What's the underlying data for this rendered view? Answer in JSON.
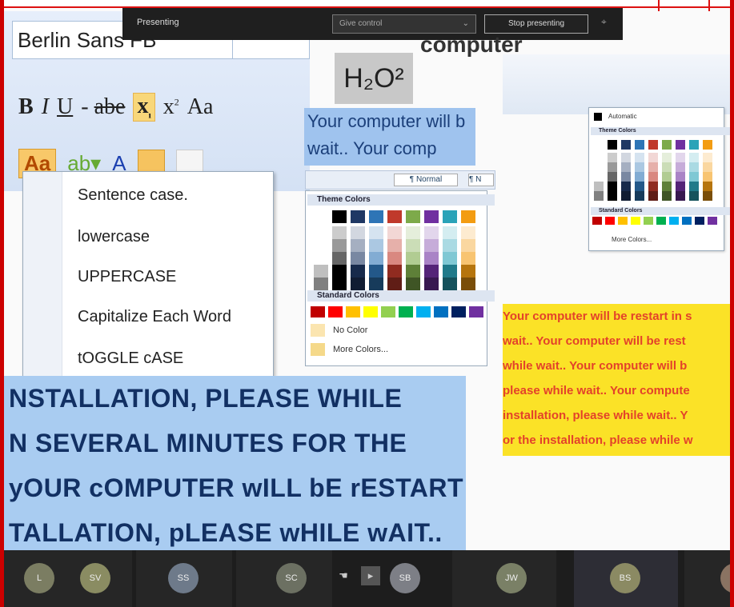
{
  "share_bar": {
    "status": "Presenting",
    "give_control": "Give control",
    "stop": "Stop presenting"
  },
  "ribbon": {
    "font_name": "Berlin Sans FB",
    "bold": "B",
    "italic": "I",
    "underline": "U",
    "strikethrough": "abe",
    "subscript": "x",
    "superscript": "x",
    "change_case": "Aa"
  },
  "case_menu": {
    "items": [
      "Sentence case.",
      "lowercase",
      "UPPERCASE",
      "Capitalize Each Word",
      "tOGGLE cASE"
    ]
  },
  "background_title": "computer",
  "h2o": "H₂O²",
  "small_doc": {
    "line1": "Your computer will b",
    "line2": "wait.. Your comp"
  },
  "center_picker": {
    "style_normal": "¶ Normal",
    "style_normal_short": "¶ N",
    "theme_colors": "Theme Colors",
    "standard_colors": "Standard Colors",
    "no_color": "No Color",
    "more_colors": "More Colors..."
  },
  "mini_picker": {
    "automatic": "Automatic",
    "theme_colors": "Theme Colors",
    "standard_colors": "Standard Colors",
    "more_colors": "More Colors..."
  },
  "yellow_doc": {
    "lines": [
      "Your computer will be restart in s",
      "wait.. Your computer will be rest",
      "while wait.. Your computer will b",
      "please while wait.. Your compute",
      "installation, please while wait.. Y",
      "or the installation, please while w"
    ]
  },
  "big_doc": {
    "lines": [
      "NSTALLATION, PLEASE WHILE",
      "N SEVERAL MINUTES FOR THE",
      "yOUR cOMPUTER wILL bE rESTART",
      "TALLATION, pLEASE wHILE wAIT.. "
    ]
  },
  "participants": {
    "avatars": [
      "L",
      "SV",
      "SS",
      "SC",
      "SB",
      "JW",
      "BS"
    ]
  },
  "colors": {
    "theme": [
      "#ffffff",
      "#000000",
      "#1f3864",
      "#2e75b6",
      "#c0392b",
      "#7daa4a",
      "#7030a0",
      "#2aa3b8",
      "#f39c12"
    ],
    "standard": [
      "#c00000",
      "#ff0000",
      "#ffc000",
      "#ffff00",
      "#92d050",
      "#00b050",
      "#00b0f0",
      "#0070c0",
      "#002060",
      "#7030a0"
    ]
  }
}
